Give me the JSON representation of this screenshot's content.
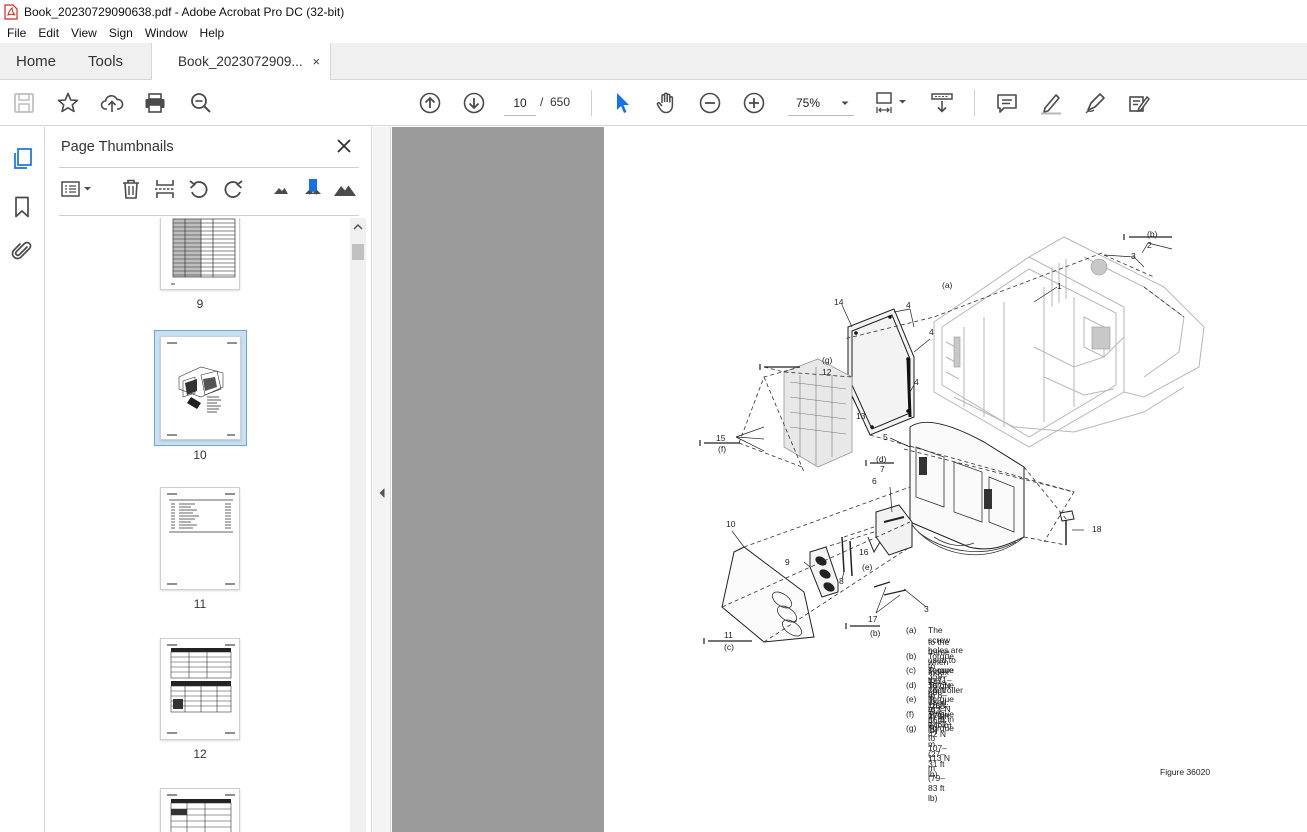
{
  "window": {
    "title": "Book_20230729090638.pdf - Adobe Acrobat Pro DC (32-bit)"
  },
  "menu": [
    "File",
    "Edit",
    "View",
    "Sign",
    "Window",
    "Help"
  ],
  "tabs": {
    "home": "Home",
    "tools": "Tools",
    "document": "Book_2023072909...",
    "close": "×"
  },
  "toolbar": {
    "current_page": "10",
    "page_separator": "/",
    "total_pages": "650",
    "zoom": "75%"
  },
  "thumbnails_panel": {
    "title": "Page Thumbnails",
    "pages": [
      {
        "label": "9"
      },
      {
        "label": "10",
        "selected": true
      },
      {
        "label": "11"
      },
      {
        "label": "12"
      }
    ]
  },
  "document": {
    "callouts": [
      "(b)",
      "2",
      "3",
      "1",
      "(a)",
      "14",
      "4",
      "4",
      "(g)",
      "12",
      "4",
      "13",
      "15",
      "(f)",
      "5",
      "(d)",
      "7",
      "6",
      "10",
      "9",
      "8",
      "16",
      "(e)",
      "18",
      "17",
      "(b)",
      "3",
      "11",
      "(c)"
    ],
    "legend": [
      {
        "key": "(a)",
        "text": "The screw holes are used to secure the controller"
      },
      {
        "key": "",
        "text": "to the frame when Index 14 is not used."
      },
      {
        "key": "(b)",
        "text": "Torque to 359–367 N m (265–271 ft lb)"
      },
      {
        "key": "(c)",
        "text": "Torque to 71–76 N m (52–56 ft lb)"
      },
      {
        "key": "(d)",
        "text": "Torque to 8–10 N m (6–7 ft lb)"
      },
      {
        "key": "(e)",
        "text": "Torque to 1 N m (8 in lb)"
      },
      {
        "key": "(f)",
        "text": "Torque to 37–42 N m (27–31 ft lb)"
      },
      {
        "key": "(g)",
        "text": "Torque to 107–113 N m (79–83 ft lb)"
      }
    ],
    "figure_label": "Figure 36020"
  },
  "colors": {
    "accent_blue": "#1473e6",
    "selected_thumb_bg": "#c9dff2",
    "doc_background": "#9b9b9b",
    "pdf_icon_red": "#d9261c"
  }
}
